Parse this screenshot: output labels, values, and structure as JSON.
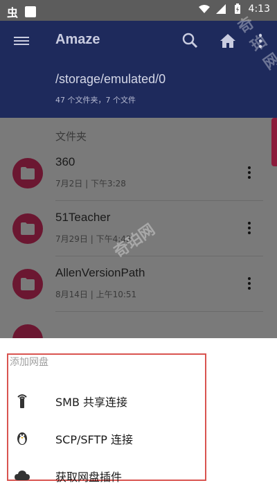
{
  "status_bar": {
    "app_glyph": "虫",
    "time": "4:13"
  },
  "toolbar": {
    "title": "Amaze",
    "path": "/storage/emulated/0",
    "summary": "47 个文件夹，7 个文件"
  },
  "list": {
    "section_header": "文件夹",
    "items": [
      {
        "name": "360",
        "meta": "7月2日 | 下午3:28"
      },
      {
        "name": "51Teacher",
        "meta": "7月29日 | 下午4:43"
      },
      {
        "name": "AllenVersionPath",
        "meta": "8月14日 | 上午10:51"
      }
    ]
  },
  "sheet": {
    "title": "添加网盘",
    "items": [
      {
        "label": "SMB 共享连接",
        "icon": "smb-signal-icon"
      },
      {
        "label": "SCP/SFTP 连接",
        "icon": "linux-penguin-icon"
      },
      {
        "label": "获取网盘插件",
        "icon": "cloud-icon"
      }
    ]
  },
  "watermark": "奇珀网",
  "colors": {
    "toolbar": "#1e2a5c",
    "accent": "#6b1731",
    "highlight_frame": "#d9534f"
  }
}
